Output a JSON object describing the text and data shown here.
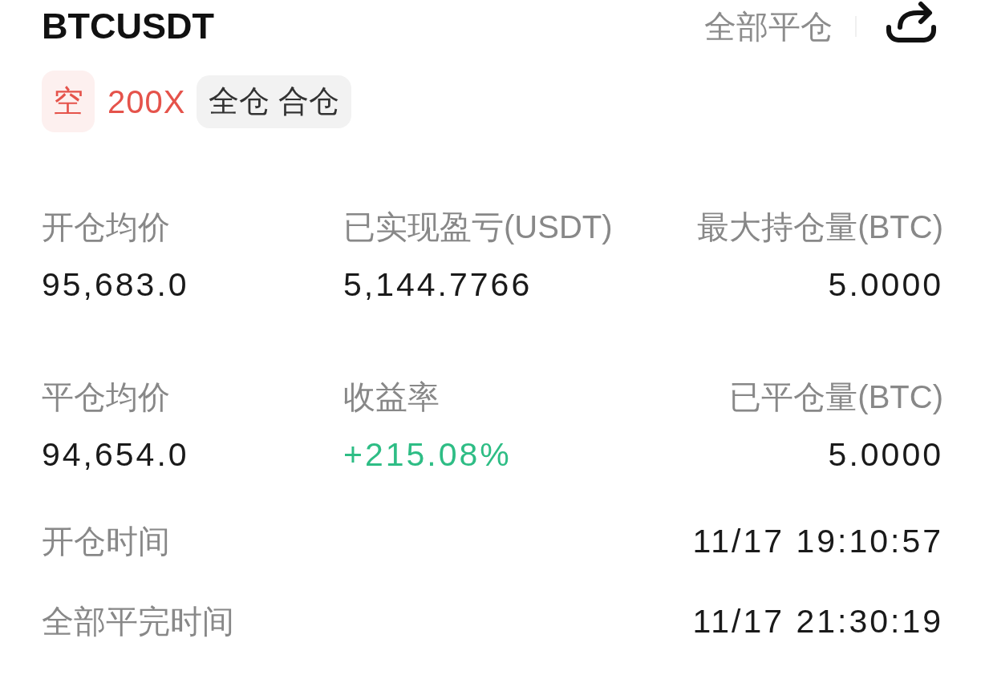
{
  "header": {
    "symbol": "BTCUSDT",
    "close_all_button": "全部平仓"
  },
  "tags": [
    {
      "kind": "side",
      "label": "空"
    },
    {
      "kind": "leverage",
      "label": "200X"
    },
    {
      "kind": "mode",
      "label": "全仓 合仓"
    }
  ],
  "stats": [
    {
      "kind": "plain",
      "label": "开仓均价",
      "value": "95,683.0"
    },
    {
      "kind": "plain",
      "label": "已实现盈亏(USDT)",
      "value": "5,144.7766"
    },
    {
      "kind": "plain",
      "label": "最大持仓量(BTC)",
      "value": "5.0000"
    },
    {
      "kind": "plain",
      "label": "平仓均价",
      "value": "94,654.0"
    },
    {
      "kind": "gain",
      "label": "收益率",
      "value": "+215.08%"
    },
    {
      "kind": "plain",
      "label": "已平仓量(BTC)",
      "value": "5.0000"
    }
  ],
  "times": [
    {
      "label": "开仓时间",
      "value": "11/17 19:10:57"
    },
    {
      "label": "全部平完时间",
      "value": "11/17 21:30:19"
    }
  ]
}
